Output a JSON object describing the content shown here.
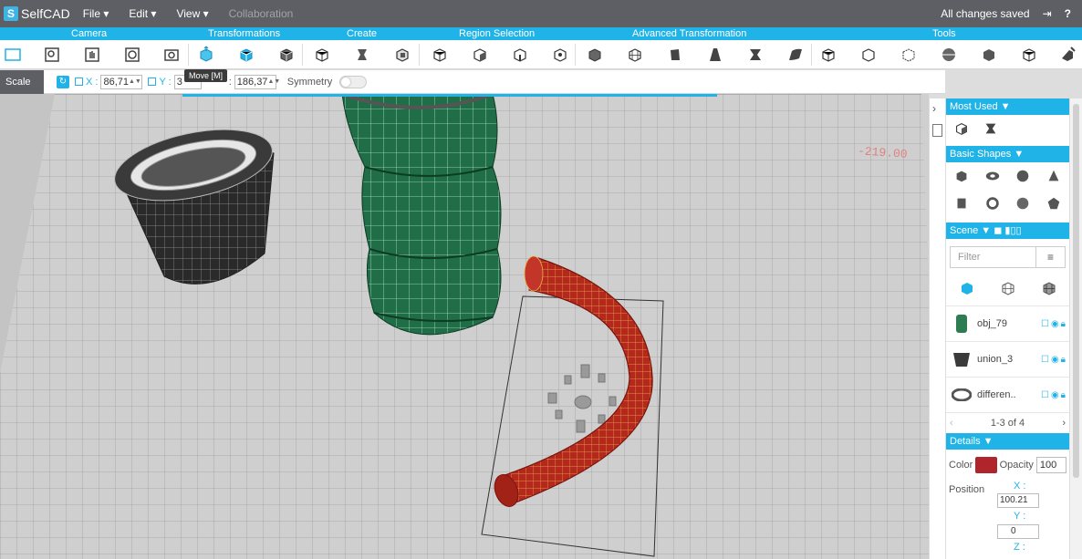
{
  "app": {
    "name": "SelfCAD"
  },
  "menu": {
    "file": "File ▾",
    "edit": "Edit ▾",
    "view": "View ▾",
    "collaboration": "Collaboration"
  },
  "status": {
    "saved": "All changes saved"
  },
  "categories": {
    "camera": "Camera",
    "transformations": "Transformations",
    "create": "Create",
    "region_selection": "Region Selection",
    "advanced_transformation": "Advanced Transformation",
    "tools": "Tools"
  },
  "tooltip": {
    "text": "Move [M]"
  },
  "propbar": {
    "mode": "Scale (L)",
    "x_label": "X :",
    "x_value": "86,71",
    "y_label": "Y :",
    "y_value": "3",
    "z_value": "186,37",
    "symmetry": "Symmetry"
  },
  "viewport": {
    "axis_readout": "-219.00"
  },
  "panel": {
    "most_used": "Most Used ▼",
    "basic_shapes": "Basic Shapes ▼",
    "scene": "Scene ▼",
    "filter_placeholder": "Filter",
    "objects": [
      {
        "name": "obj_79",
        "color": "#2e7d52"
      },
      {
        "name": "union_3",
        "color": "#3a3a3a"
      },
      {
        "name": "differen..",
        "color": "#555555"
      }
    ],
    "pager": "1-3 of 4",
    "details": "Details ▼",
    "color_label": "Color",
    "object_color": "#b0252b",
    "opacity_label": "Opacity",
    "opacity_value": "100",
    "position_label": "Position",
    "pos_x_label": "X :",
    "pos_x": "100.21",
    "pos_y_label": "Y :",
    "pos_y": "0",
    "pos_z_label": "Z :"
  },
  "colors": {
    "accent": "#1fb3e8",
    "topbar": "#5d5f64"
  }
}
